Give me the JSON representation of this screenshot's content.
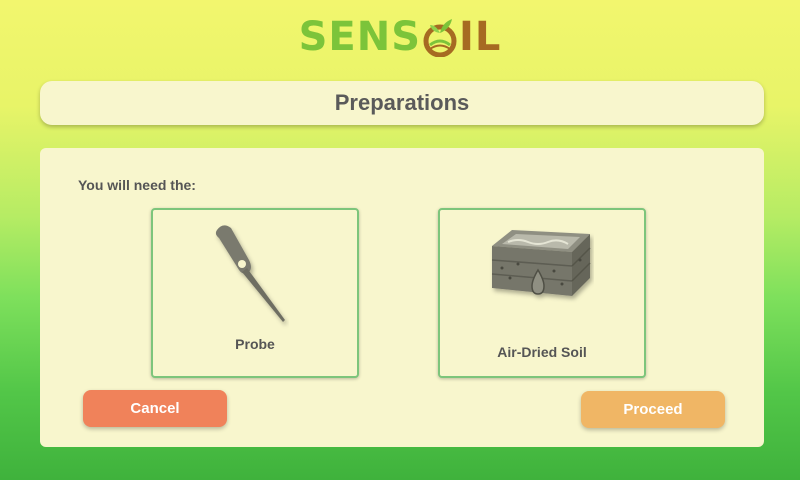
{
  "app": {
    "logo_part1": "SENS",
    "logo_part2": "IL",
    "colors": {
      "logo_green": "#7cc43a",
      "logo_brown": "#a66a22",
      "accent_border": "#7dc57b"
    }
  },
  "header": {
    "title": "Preparations"
  },
  "main": {
    "intro": "You will need the:",
    "items": [
      {
        "label": "Probe",
        "icon": "probe-icon"
      },
      {
        "label": "Air-Dried Soil",
        "icon": "soil-crate-icon"
      }
    ]
  },
  "actions": {
    "cancel_label": "Cancel",
    "cancel_color": "#f0825a",
    "proceed_label": "Proceed",
    "proceed_color": "#f0b665"
  }
}
